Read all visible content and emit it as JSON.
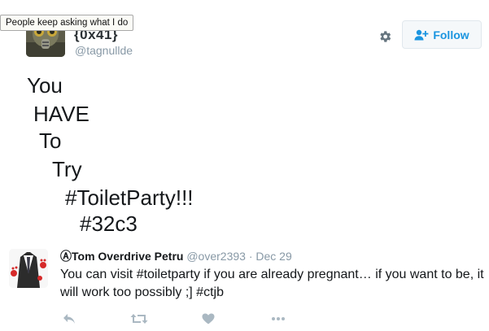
{
  "tooltip": {
    "text": "People keep asking what I do"
  },
  "profile": {
    "display_name": "{0x41}",
    "screen_name": "@tagnullde",
    "avatar_icon": "gas-mask-avatar"
  },
  "header_actions": {
    "settings_icon": "gear-icon",
    "follow_label": "Follow",
    "follow_icon": "add-user-icon"
  },
  "tweet": {
    "lines": [
      "You",
      "HAVE",
      "To",
      "Try",
      "#ToiletParty!!!",
      "#32c3"
    ]
  },
  "reply": {
    "name": "ⒶTom Overdrive Petru",
    "handle": "@over2393",
    "separator": "·",
    "date": "Dec 29",
    "text": "You can visit #toiletparty if you are already pregnant… if you want to be, it will work too possibly ;] #ctjb",
    "avatar_icon": "suit-avatar",
    "actions": [
      "reply-icon",
      "retweet-icon",
      "heart-icon",
      "more-icon"
    ]
  },
  "colors": {
    "accent": "#1b95e0",
    "muted": "#8899a6",
    "icon": "#aab8c2",
    "text": "#14171a"
  }
}
